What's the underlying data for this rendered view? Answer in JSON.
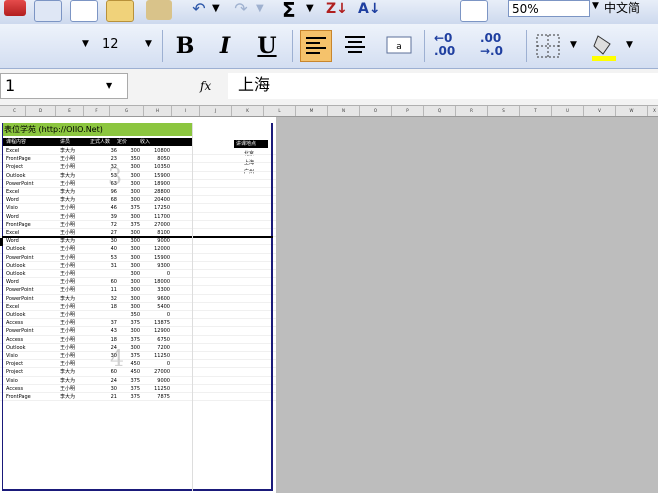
{
  "toolbar1": {
    "zoom": "50%",
    "lang": "中文简"
  },
  "toolbar2": {
    "font_size": "12",
    "bold": "B",
    "italic": "I",
    "underline": "U",
    "decimal_add_top": "←0",
    "decimal_add_bottom": ".00",
    "decimal_remove_top": ".00",
    "decimal_remove_bottom": "→.0"
  },
  "formula_bar": {
    "name_box": "1",
    "fx": "fx",
    "value": "上海"
  },
  "columns": [
    "C",
    "D",
    "E",
    "F",
    "G",
    "H",
    "I",
    "J",
    "K",
    "L",
    "M",
    "N",
    "O",
    "P",
    "Q",
    "R",
    "S",
    "T",
    "U",
    "V",
    "W",
    "X"
  ],
  "sheet": {
    "banner": "表位学苑 (http://OIIO.Net)",
    "headers": [
      "课程内容",
      "讲员",
      "正式人数",
      "定价",
      "收入"
    ],
    "side_header": "讲课地点",
    "side_values": [
      "北京",
      "上海",
      "广州"
    ],
    "rows": [
      [
        "Excel",
        "李大为",
        "36",
        "300",
        "10800"
      ],
      [
        "FrontPage",
        "王小明",
        "23",
        "350",
        "8050"
      ],
      [
        "Project",
        "王小明",
        "32",
        "300",
        "10350"
      ],
      [
        "Outlook",
        "李大为",
        "53",
        "300",
        "15900"
      ],
      [
        "PowerPoint",
        "王小明",
        "63",
        "300",
        "18900"
      ],
      [
        "Excel",
        "李大为",
        "96",
        "300",
        "28800"
      ],
      [
        "Word",
        "李大为",
        "68",
        "300",
        "20400"
      ],
      [
        "Visio",
        "王小明",
        "46",
        "375",
        "17250"
      ],
      [
        "Word",
        "王小明",
        "39",
        "300",
        "11700"
      ],
      [
        "FrontPage",
        "王小明",
        "72",
        "375",
        "27000"
      ],
      [
        "Excel",
        "王小明",
        "27",
        "300",
        "8100"
      ],
      [
        "Word",
        "李大为",
        "30",
        "300",
        "9000"
      ],
      [
        "Outlook",
        "王小明",
        "40",
        "300",
        "12000"
      ],
      [
        "PowerPoint",
        "王小明",
        "53",
        "300",
        "15900"
      ],
      [
        "Outlook",
        "王小明",
        "31",
        "300",
        "9300"
      ],
      [
        "Outlook",
        "王小明",
        "",
        "300",
        "0"
      ],
      [
        "Word",
        "王小明",
        "60",
        "300",
        "18000"
      ],
      [
        "PowerPoint",
        "王小明",
        "11",
        "300",
        "3300"
      ],
      [
        "PowerPoint",
        "李大为",
        "32",
        "300",
        "9600"
      ],
      [
        "Excel",
        "王小明",
        "18",
        "300",
        "5400"
      ],
      [
        "Outlook",
        "王小明",
        "",
        "350",
        "0"
      ],
      [
        "Access",
        "王小明",
        "37",
        "375",
        "13875"
      ],
      [
        "PowerPoint",
        "王小明",
        "43",
        "300",
        "12900"
      ],
      [
        "Access",
        "王小明",
        "18",
        "375",
        "6750"
      ],
      [
        "Outlook",
        "王小明",
        "24",
        "300",
        "7200"
      ],
      [
        "Visio",
        "王小明",
        "30",
        "375",
        "11250"
      ],
      [
        "Project",
        "王小明",
        "",
        "450",
        "0"
      ],
      [
        "Project",
        "李大为",
        "60",
        "450",
        "27000"
      ],
      [
        "Visio",
        "李大为",
        "24",
        "375",
        "9000"
      ],
      [
        "Access",
        "王小明",
        "30",
        "375",
        "11250"
      ],
      [
        "FrontPage",
        "李大为",
        "21",
        "375",
        "7875"
      ]
    ]
  },
  "watermarks": [
    "3",
    "4"
  ],
  "colors": {
    "banner_bg": "#8cc63f",
    "header_bg": "#000000",
    "border": "#1a1a7a",
    "active_btn": "#f5c26b"
  }
}
